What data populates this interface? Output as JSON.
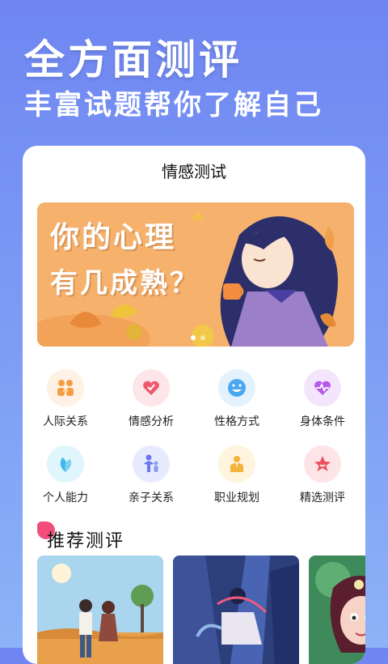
{
  "hero": {
    "title": "全方面测评",
    "subtitle": "丰富试题帮你了解自己"
  },
  "screen": {
    "title": "情感测试",
    "banner": {
      "line1": "你的心理",
      "line2": "有几成熟？",
      "colors": {
        "bg": "#F6B26D",
        "hair": "#2D2F6B",
        "dress": "#9C7FC9"
      },
      "active_page": 1,
      "page_count": 2
    },
    "categories": [
      {
        "label": "人际关系",
        "icon": "people-icon",
        "color": "#F59C45"
      },
      {
        "label": "情感分析",
        "icon": "heart-icon",
        "color": "#F0596D"
      },
      {
        "label": "性格方式",
        "icon": "smile-icon",
        "color": "#4AA8F0"
      },
      {
        "label": "身体条件",
        "icon": "heartbeat-icon",
        "color": "#B45BEA"
      },
      {
        "label": "个人能力",
        "icon": "leaf-icon",
        "color": "#3FB8E8"
      },
      {
        "label": "亲子关系",
        "icon": "family-icon",
        "color": "#6A78F0"
      },
      {
        "label": "职业规划",
        "icon": "briefcase-person-icon",
        "color": "#F4B33A"
      },
      {
        "label": "精选测评",
        "icon": "star-icon",
        "color": "#EF4F5E"
      }
    ],
    "recommend": {
      "title": "推荐测评",
      "accent": "#F24D7B"
    }
  }
}
